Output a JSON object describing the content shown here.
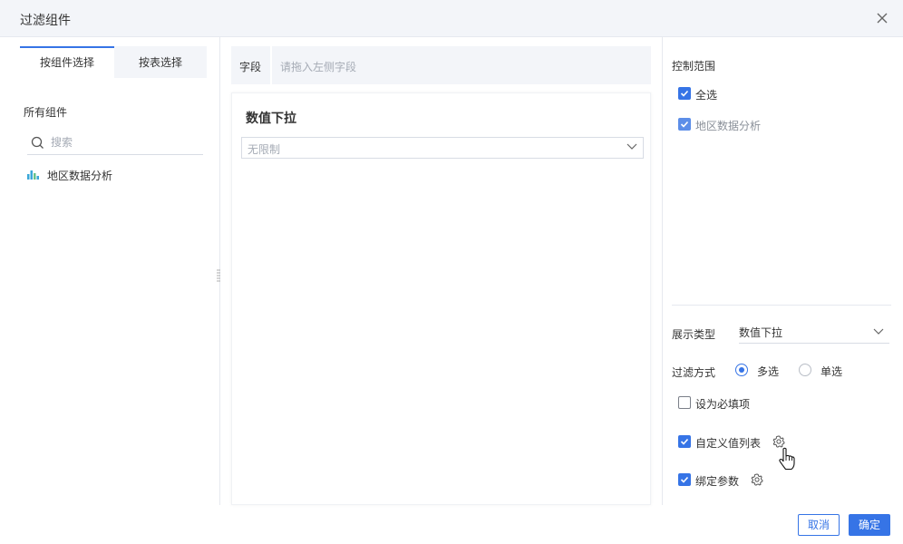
{
  "dialog": {
    "title": "过滤组件",
    "close_icon": "close-icon"
  },
  "left_panel": {
    "tabs": [
      {
        "label": "按组件选择",
        "active": true
      },
      {
        "label": "按表选择",
        "active": false
      }
    ],
    "section_label": "所有组件",
    "search": {
      "placeholder": "搜索",
      "value": ""
    },
    "components": [
      {
        "label": "地区数据分析",
        "icon": "bar-chart-icon"
      }
    ]
  },
  "field": {
    "label": "字段",
    "placeholder": "请拖入左侧字段"
  },
  "preview": {
    "title": "数值下拉",
    "select_placeholder": "无限制"
  },
  "right_panel": {
    "scope_title": "控制范围",
    "scope_items": [
      {
        "label": "全选",
        "checked": true
      },
      {
        "label": "地区数据分析",
        "checked": true
      }
    ],
    "display_type_label": "展示类型",
    "display_type_value": "数值下拉",
    "filter_mode_label": "过滤方式",
    "filter_modes": [
      {
        "label": "多选",
        "selected": true
      },
      {
        "label": "单选",
        "selected": false
      }
    ],
    "options": [
      {
        "label": "设为必填项",
        "checked": false
      },
      {
        "label": "自定义值列表",
        "checked": true,
        "has_settings": true
      },
      {
        "label": "绑定参数",
        "checked": true,
        "has_settings": true
      }
    ]
  },
  "footer": {
    "cancel_label": "取消",
    "ok_label": "确定"
  },
  "colors": {
    "accent": "#3674e6",
    "header_bg": "#f3f5f9",
    "border": "#e6e9ef"
  }
}
